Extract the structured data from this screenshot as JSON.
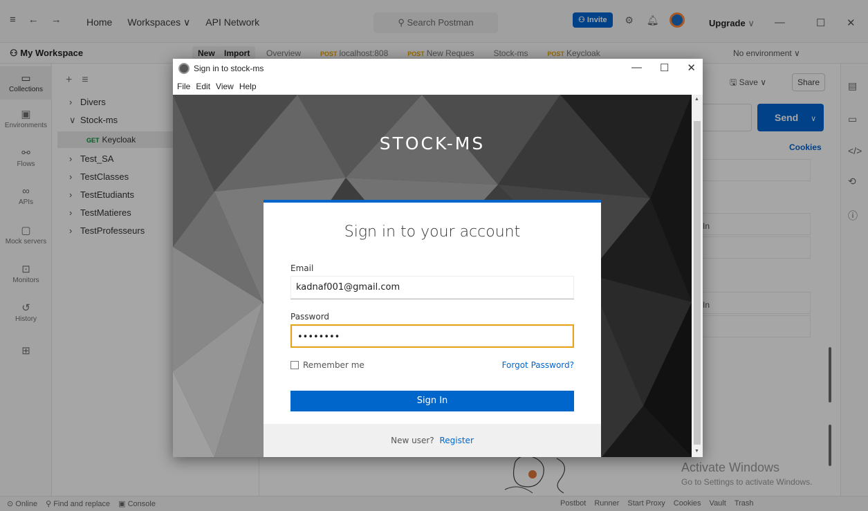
{
  "postman": {
    "nav": {
      "home": "Home",
      "workspaces": "Workspaces ∨",
      "api_network": "API Network"
    },
    "search_placeholder": "Search Postman",
    "invite": "Invite",
    "upgrade": "Upgrade",
    "workspace_name": "My Workspace",
    "new_btn": "New",
    "import_btn": "Import",
    "tabs": [
      {
        "label": "Overview",
        "method": ""
      },
      {
        "label": "localhost:808",
        "method": "POST"
      },
      {
        "label": "New Reques",
        "method": "POST"
      },
      {
        "label": "Stock-ms",
        "method": ""
      },
      {
        "label": "Keycloak",
        "method": "POST"
      }
    ],
    "no_environment": "No environment",
    "rail": [
      "Collections",
      "Environments",
      "Flows",
      "APIs",
      "Mock servers",
      "Monitors",
      "History"
    ],
    "collections": [
      "Divers",
      "Stock-ms",
      "Test_SA",
      "TestClasses",
      "TestEtudiants",
      "TestMatieres",
      "TestProfesseurs"
    ],
    "sub_request": {
      "method": "GET",
      "name": "Keycloak"
    },
    "save": "Save",
    "share": "Share",
    "send": "Send",
    "cookies": "Cookies",
    "status_left": [
      "Online",
      "Find and replace",
      "Console"
    ],
    "status_right": [
      "Postbot",
      "Runner",
      "Start Proxy",
      "Cookies",
      "Vault",
      "Trash"
    ],
    "activate_title": "Activate Windows",
    "activate_sub": "Go to Settings to activate Windows."
  },
  "dialog": {
    "window_title": "Sign in to stock-ms",
    "menu": [
      "File",
      "Edit",
      "View",
      "Help"
    ],
    "realm": "STOCK-MS",
    "card_title": "Sign in to your account",
    "email_label": "Email",
    "email_value": "kadnaf001@gmail.com",
    "password_label": "Password",
    "password_mask": "••••••••",
    "remember": "Remember me",
    "forgot": "Forgot Password?",
    "signin": "Sign In",
    "new_user": "New user?",
    "register": "Register"
  }
}
